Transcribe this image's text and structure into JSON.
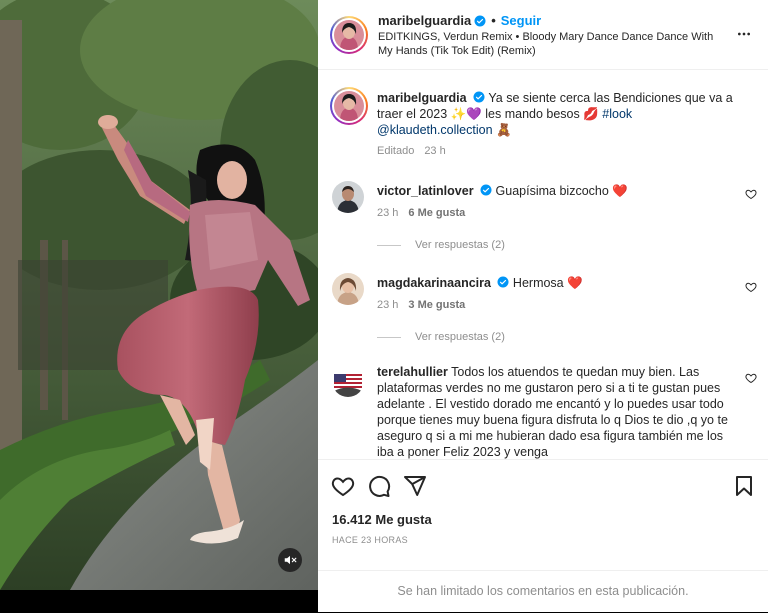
{
  "post": {
    "username": "maribelguardia",
    "follow_label": "Seguir",
    "separator": "•",
    "audio": "EDITKINGS, Verdun Remix • Bloody Mary Dance Dance Dance With My Hands (Tik Tok Edit) (Remix)",
    "more_icon": "more-horizontal-icon"
  },
  "caption": {
    "username": "maribelguardia",
    "text_1": "Ya se siente cerca las Bendiciones que va a traer el 2023 ✨💜 les mando besos 💋 ",
    "hashtag": "#look",
    "mention": "@klaudeth.collection",
    "text_2": " 🧸",
    "edited": "Editado",
    "time": "23 h"
  },
  "comments": [
    {
      "username": "victor_latinlover",
      "verified": true,
      "text": "Guapísima bizcocho ❤️",
      "time": "23 h",
      "likes": "6 Me gusta",
      "replies": "Ver respuestas (2)"
    },
    {
      "username": "magdakarinaancira",
      "verified": true,
      "text": "Hermosa ❤️",
      "time": "23 h",
      "likes": "3 Me gusta",
      "replies": "Ver respuestas (2)"
    },
    {
      "username": "terelahullier",
      "verified": false,
      "text": "Todos los atuendos te quedan muy bien. Las plataformas verdes no me gustaron pero si a ti te gustan pues adelante . El vestido dorado me encantó y lo puedes usar todo porque tienes muy buena figura disfruta lo q Dios te dio ,q yo te aseguro q si a mi me hubieran dado esa figura también me los iba a poner Feliz 2023 y venga"
    }
  ],
  "actions": {
    "like_icon": "heart-icon",
    "comment_icon": "comment-icon",
    "share_icon": "share-icon",
    "save_icon": "bookmark-icon",
    "likes": "16.412 Me gusta",
    "posted": "HACE 23 HORAS"
  },
  "footer": {
    "limited": "Se han limitado los comentarios en esta publicación."
  },
  "media": {
    "mute_icon": "muted-speaker-icon"
  },
  "colors": {
    "accent": "#0095f6",
    "verified": "#0095f6",
    "heart_red": "#ed4956",
    "muted_text": "#8e8e8e"
  }
}
